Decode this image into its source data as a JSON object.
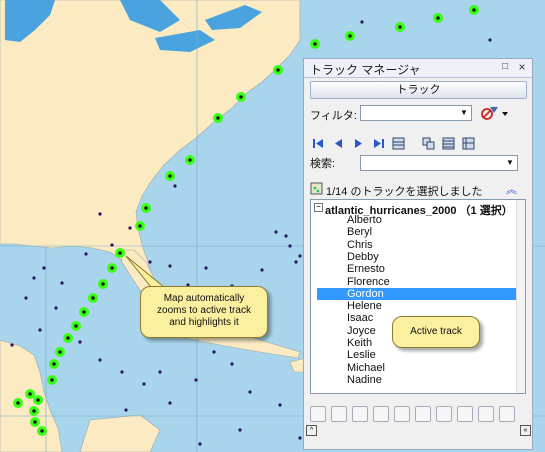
{
  "panel": {
    "title": "トラック マネージャ",
    "pin_icon": "□",
    "close_icon": "×",
    "tab_label": "トラック",
    "filter_label": "フィルタ:",
    "search_label": "検索:",
    "status_text": "1/14 のトラックを選択しました",
    "root_label": "atlantic_hurricanes_2000 （1 選択）",
    "tracks": [
      "Alberto",
      "Beryl",
      "Chris",
      "Debby",
      "Ernesto",
      "Florence",
      "Gordon",
      "Helene",
      "Isaac",
      "Joyce",
      "Keith",
      "Leslie",
      "Michael",
      "Nadine"
    ],
    "selected_track": "Gordon"
  },
  "callouts": {
    "map_note": "Map automatically zooms to active track and highlights it",
    "track_note": "Active track"
  },
  "colors": {
    "water": "#a8d4ec",
    "land": "#fbeac2",
    "highlight_green": "#39ff14",
    "selection_blue": "#3399ff",
    "callout_fill": "#fbf0a0"
  }
}
